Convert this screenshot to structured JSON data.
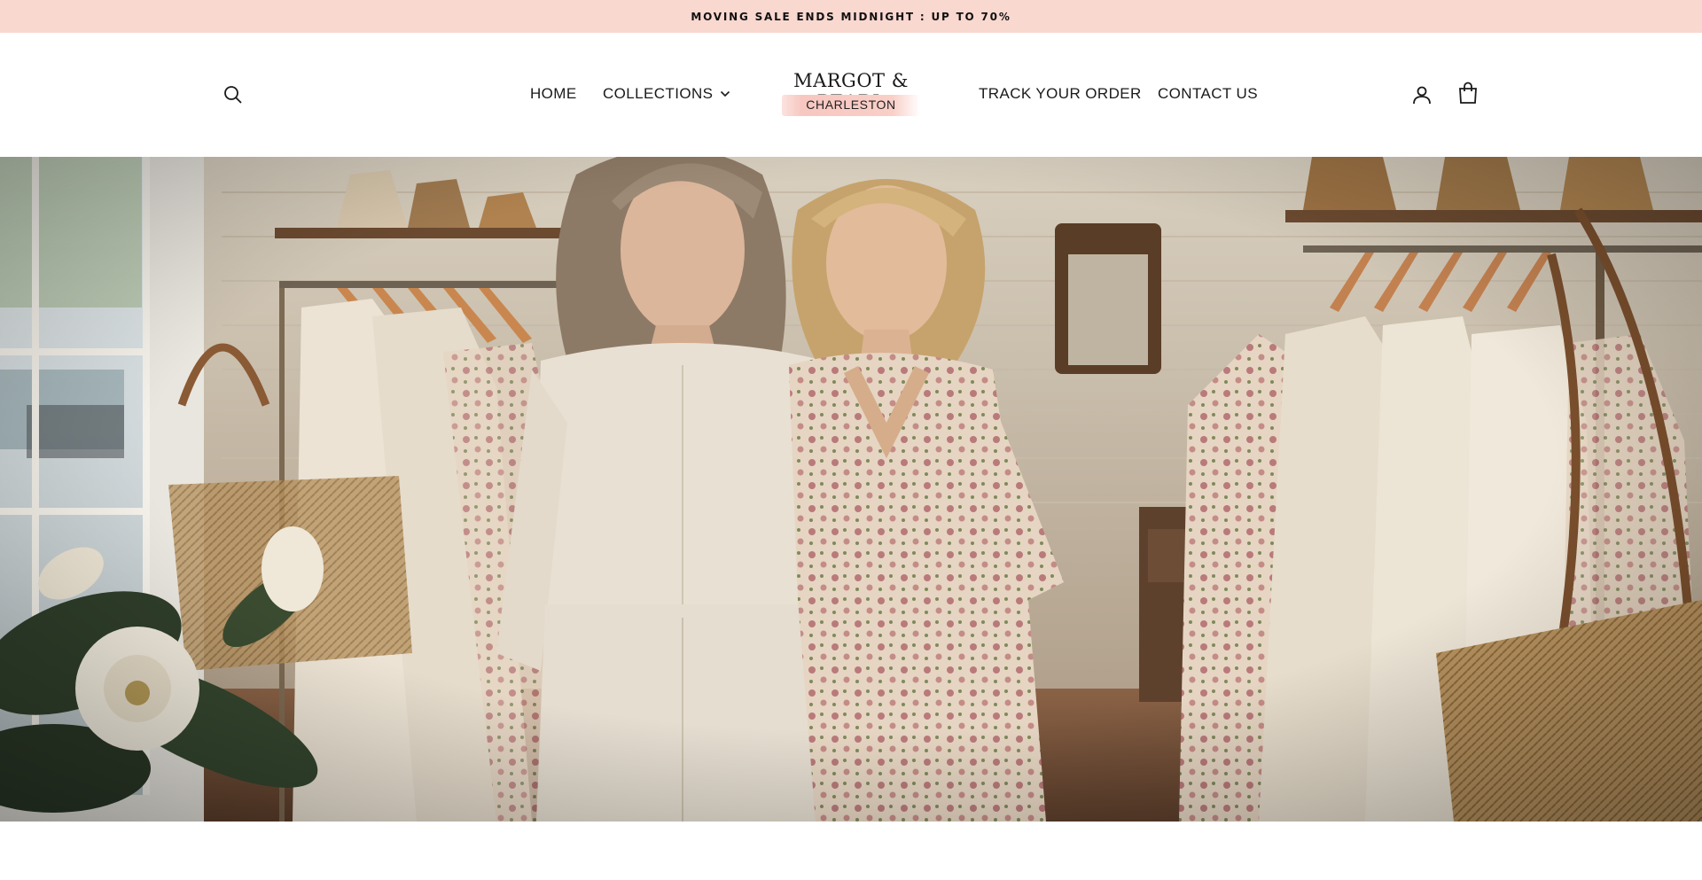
{
  "announcement": {
    "text": "MOVING SALE ENDS MIDNIGHT : UP TO 70%"
  },
  "header": {
    "nav": {
      "home": "HOME",
      "collections": "COLLECTIONS",
      "track_order": "TRACK YOUR ORDER",
      "contact": "CONTACT US"
    },
    "logo": {
      "name": "MARGOT & PEARL",
      "location": "CHARLESTON"
    },
    "icons": {
      "search": "search-icon",
      "collections_dropdown": "chevron-down-icon",
      "account": "user-icon",
      "cart": "cart-icon"
    }
  },
  "hero": {
    "image": "boutique-hero-image"
  },
  "colors": {
    "announcement_bg": "#f9d8d0",
    "logo_accent": "#f7c7c0",
    "text": "#1a1a1a"
  }
}
